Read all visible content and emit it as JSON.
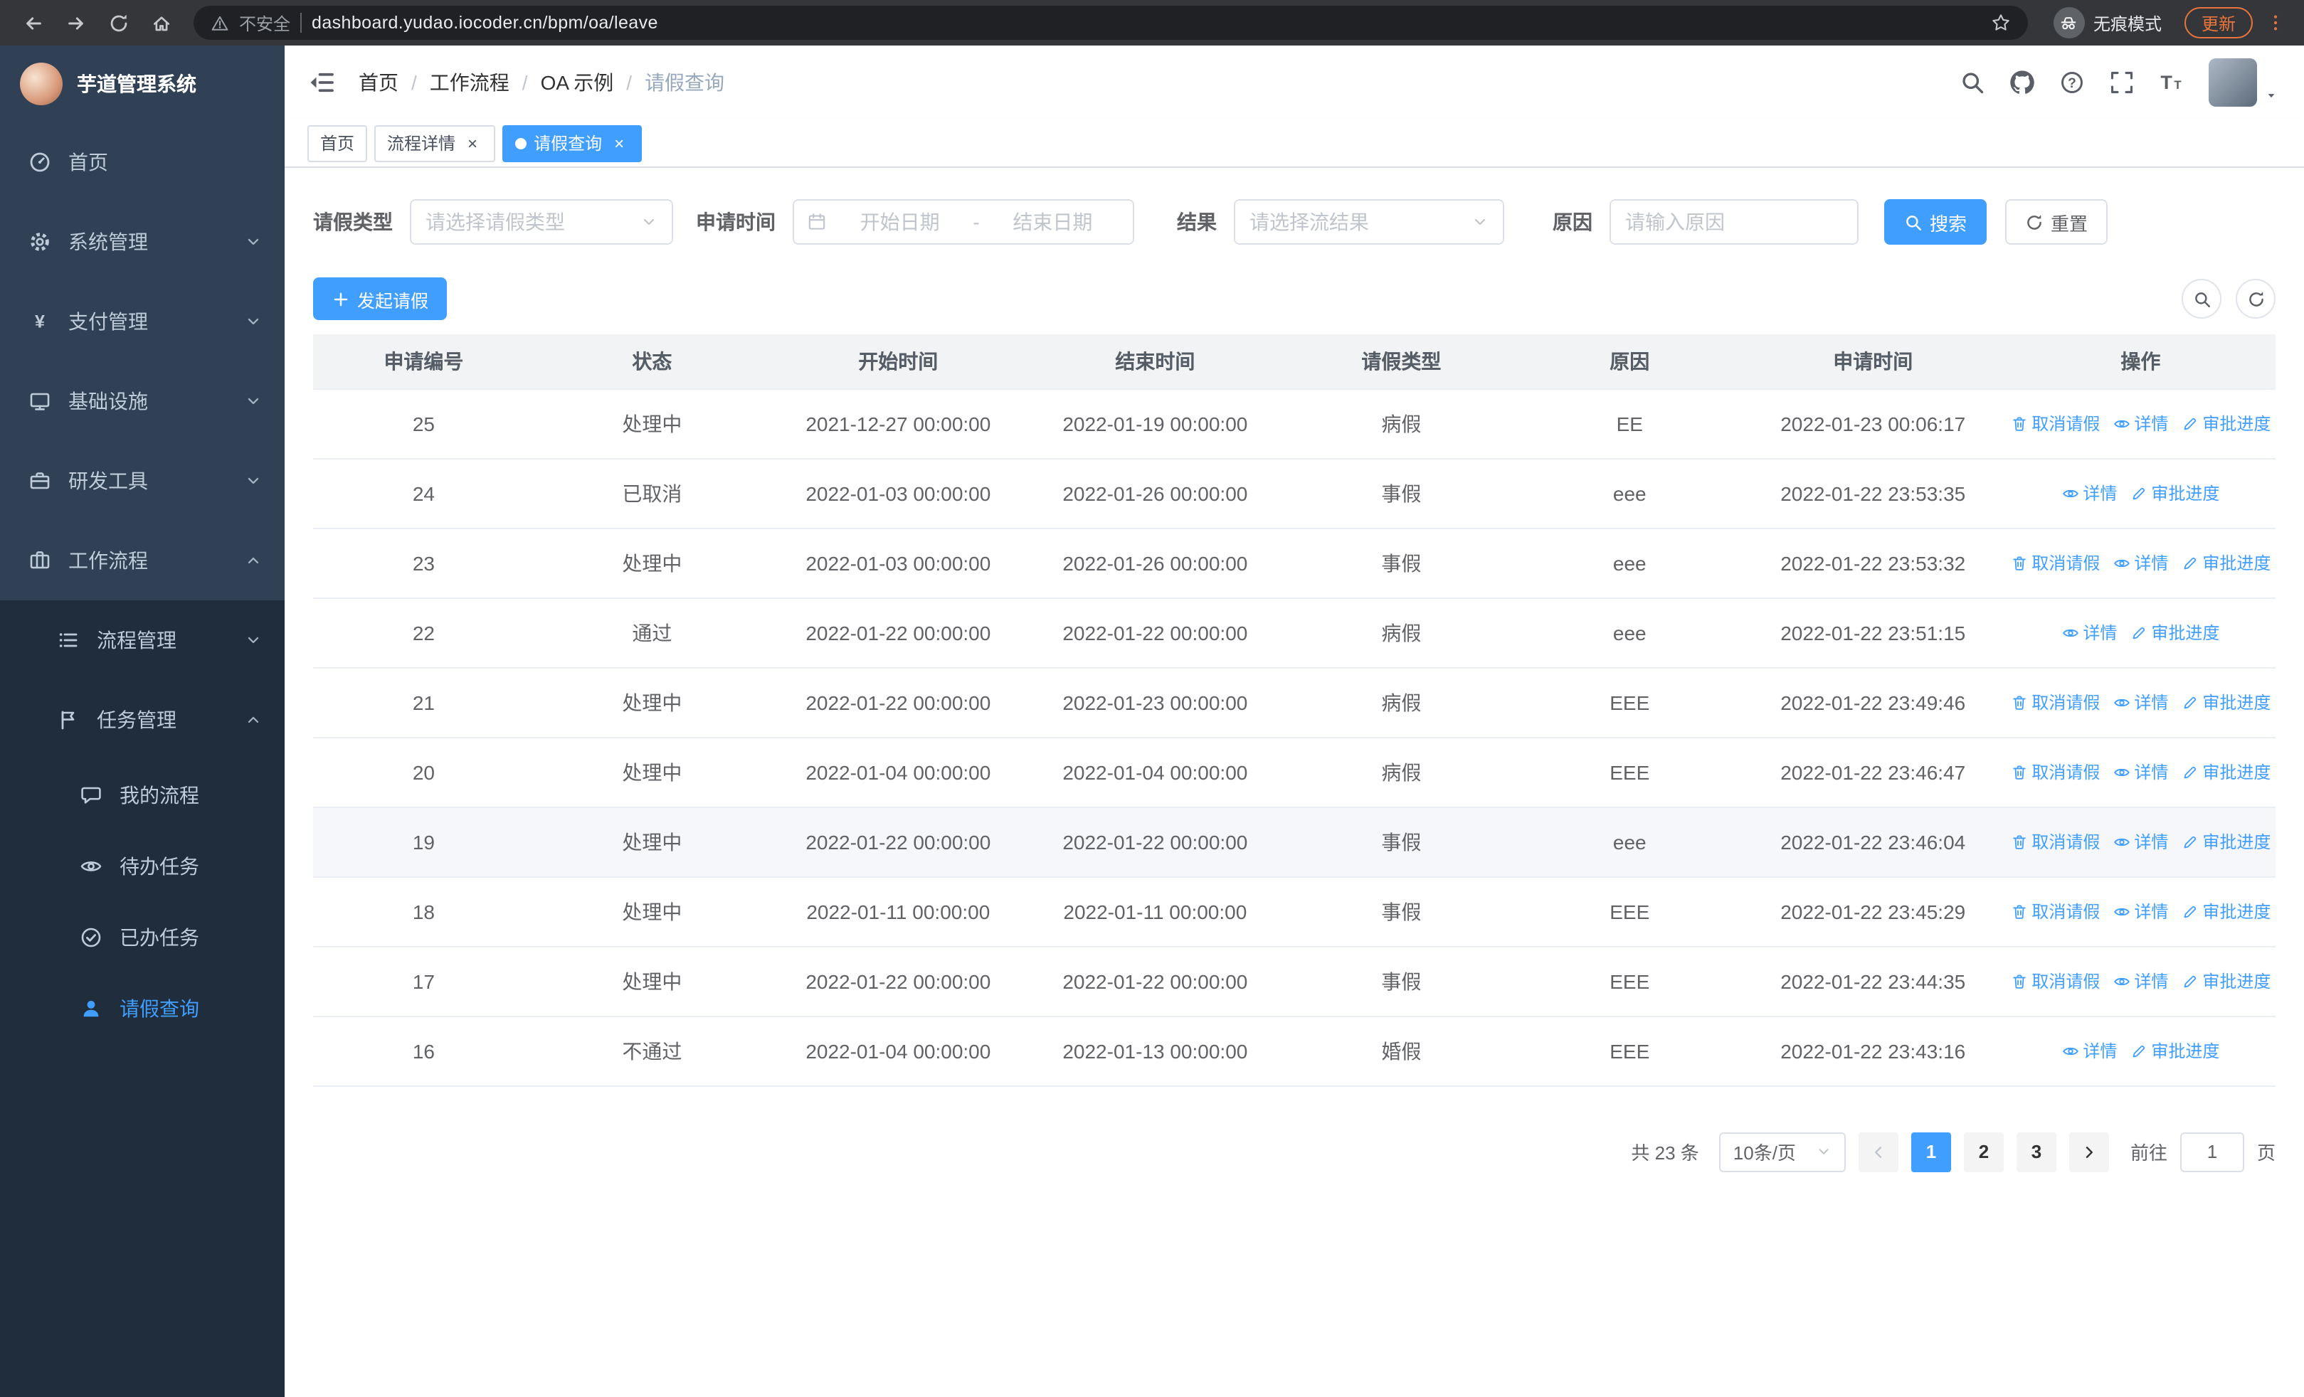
{
  "colors": {
    "primary": "#409eff",
    "sidebar_bg": "#304156",
    "sidebar_submenu_bg": "#1f2d3d",
    "update_accent": "#e9743c"
  },
  "browser": {
    "security_label": "不安全",
    "url": "dashboard.yudao.iocoder.cn/bpm/oa/leave",
    "incognito_label": "无痕模式",
    "update_label": "更新"
  },
  "sidebar": {
    "app_title": "芋道管理系统",
    "items": [
      {
        "name": "sidebar-item-home",
        "label": "首页",
        "icon": "dashboard",
        "level": 1
      },
      {
        "name": "sidebar-item-system-mgmt",
        "label": "系统管理",
        "icon": "gear",
        "level": 1,
        "chevron": "down"
      },
      {
        "name": "sidebar-item-payment-mgmt",
        "label": "支付管理",
        "icon": "yen",
        "level": 1,
        "chevron": "down"
      },
      {
        "name": "sidebar-item-infrastructure",
        "label": "基础设施",
        "icon": "monitor",
        "level": 1,
        "chevron": "down"
      },
      {
        "name": "sidebar-item-dev-tools",
        "label": "研发工具",
        "icon": "toolbox",
        "level": 1,
        "chevron": "down"
      },
      {
        "name": "sidebar-item-workflow",
        "label": "工作流程",
        "icon": "briefcase",
        "level": 1,
        "chevron": "up"
      },
      {
        "name": "sidebar-item-process-mgmt",
        "label": "流程管理",
        "icon": "list",
        "level": 2,
        "chevron": "down"
      },
      {
        "name": "sidebar-item-task-mgmt",
        "label": "任务管理",
        "icon": "flag",
        "level": 2,
        "chevron": "up"
      },
      {
        "name": "sidebar-item-my-process",
        "label": "我的流程",
        "icon": "chat",
        "level": 3
      },
      {
        "name": "sidebar-item-todo-tasks",
        "label": "待办任务",
        "icon": "eye",
        "level": 3
      },
      {
        "name": "sidebar-item-done-tasks",
        "label": "已办任务",
        "icon": "check-circle",
        "level": 3
      },
      {
        "name": "sidebar-item-leave-query",
        "label": "请假查询",
        "icon": "user",
        "level": 3,
        "active": true
      }
    ]
  },
  "header": {
    "breadcrumbs": [
      "首页",
      "工作流程",
      "OA 示例",
      "请假查询"
    ]
  },
  "tabs": [
    {
      "name": "tab-home",
      "label": "首页",
      "closable": false,
      "active": false
    },
    {
      "name": "tab-process-detail",
      "label": "流程详情",
      "closable": true,
      "active": false
    },
    {
      "name": "tab-leave-query",
      "label": "请假查询",
      "closable": true,
      "active": true
    }
  ],
  "filters": {
    "leave_type_label": "请假类型",
    "leave_type_placeholder": "请选择请假类型",
    "apply_time_label": "申请时间",
    "start_date_placeholder": "开始日期",
    "range_separator": "-",
    "end_date_placeholder": "结束日期",
    "result_label": "结果",
    "result_placeholder": "请选择流结果",
    "reason_label": "原因",
    "reason_placeholder": "请输入原因",
    "search_label": "搜索",
    "reset_label": "重置"
  },
  "toolbar": {
    "create_label": "发起请假"
  },
  "table": {
    "columns": [
      "申请编号",
      "状态",
      "开始时间",
      "结束时间",
      "请假类型",
      "原因",
      "申请时间",
      "操作"
    ],
    "action_defs": {
      "cancel": {
        "label": "取消请假",
        "icon": "trash"
      },
      "detail": {
        "label": "详情",
        "icon": "eye"
      },
      "progress": {
        "label": "审批进度",
        "icon": "edit"
      }
    },
    "rows": [
      {
        "id": "25",
        "status": "处理中",
        "start_time": "2021-12-27 00:00:00",
        "end_time": "2022-01-19 00:00:00",
        "leave_type": "病假",
        "reason": "EE",
        "apply_time": "2022-01-23 00:06:17",
        "actions": [
          "cancel",
          "detail",
          "progress"
        ]
      },
      {
        "id": "24",
        "status": "已取消",
        "start_time": "2022-01-03 00:00:00",
        "end_time": "2022-01-26 00:00:00",
        "leave_type": "事假",
        "reason": "eee",
        "apply_time": "2022-01-22 23:53:35",
        "actions": [
          "detail",
          "progress"
        ]
      },
      {
        "id": "23",
        "status": "处理中",
        "start_time": "2022-01-03 00:00:00",
        "end_time": "2022-01-26 00:00:00",
        "leave_type": "事假",
        "reason": "eee",
        "apply_time": "2022-01-22 23:53:32",
        "actions": [
          "cancel",
          "detail",
          "progress"
        ]
      },
      {
        "id": "22",
        "status": "通过",
        "start_time": "2022-01-22 00:00:00",
        "end_time": "2022-01-22 00:00:00",
        "leave_type": "病假",
        "reason": "eee",
        "apply_time": "2022-01-22 23:51:15",
        "actions": [
          "detail",
          "progress"
        ]
      },
      {
        "id": "21",
        "status": "处理中",
        "start_time": "2022-01-22 00:00:00",
        "end_time": "2022-01-23 00:00:00",
        "leave_type": "病假",
        "reason": "EEE",
        "apply_time": "2022-01-22 23:49:46",
        "actions": [
          "cancel",
          "detail",
          "progress"
        ]
      },
      {
        "id": "20",
        "status": "处理中",
        "start_time": "2022-01-04 00:00:00",
        "end_time": "2022-01-04 00:00:00",
        "leave_type": "病假",
        "reason": "EEE",
        "apply_time": "2022-01-22 23:46:47",
        "actions": [
          "cancel",
          "detail",
          "progress"
        ]
      },
      {
        "id": "19",
        "status": "处理中",
        "start_time": "2022-01-22 00:00:00",
        "end_time": "2022-01-22 00:00:00",
        "leave_type": "事假",
        "reason": "eee",
        "apply_time": "2022-01-22 23:46:04",
        "actions": [
          "cancel",
          "detail",
          "progress"
        ],
        "highlighted": true
      },
      {
        "id": "18",
        "status": "处理中",
        "start_time": "2022-01-11 00:00:00",
        "end_time": "2022-01-11 00:00:00",
        "leave_type": "事假",
        "reason": "EEE",
        "apply_time": "2022-01-22 23:45:29",
        "actions": [
          "cancel",
          "detail",
          "progress"
        ]
      },
      {
        "id": "17",
        "status": "处理中",
        "start_time": "2022-01-22 00:00:00",
        "end_time": "2022-01-22 00:00:00",
        "leave_type": "事假",
        "reason": "EEE",
        "apply_time": "2022-01-22 23:44:35",
        "actions": [
          "cancel",
          "detail",
          "progress"
        ]
      },
      {
        "id": "16",
        "status": "不通过",
        "start_time": "2022-01-04 00:00:00",
        "end_time": "2022-01-13 00:00:00",
        "leave_type": "婚假",
        "reason": "EEE",
        "apply_time": "2022-01-22 23:43:16",
        "actions": [
          "detail",
          "progress"
        ]
      }
    ]
  },
  "pagination": {
    "total_label": "共 23 条",
    "page_size": "10条/页",
    "pages": [
      {
        "label": "1",
        "active": true
      },
      {
        "label": "2",
        "active": false
      },
      {
        "label": "3",
        "active": false
      }
    ],
    "goto_label": "前往",
    "goto_value": "1",
    "page_suffix": "页"
  }
}
